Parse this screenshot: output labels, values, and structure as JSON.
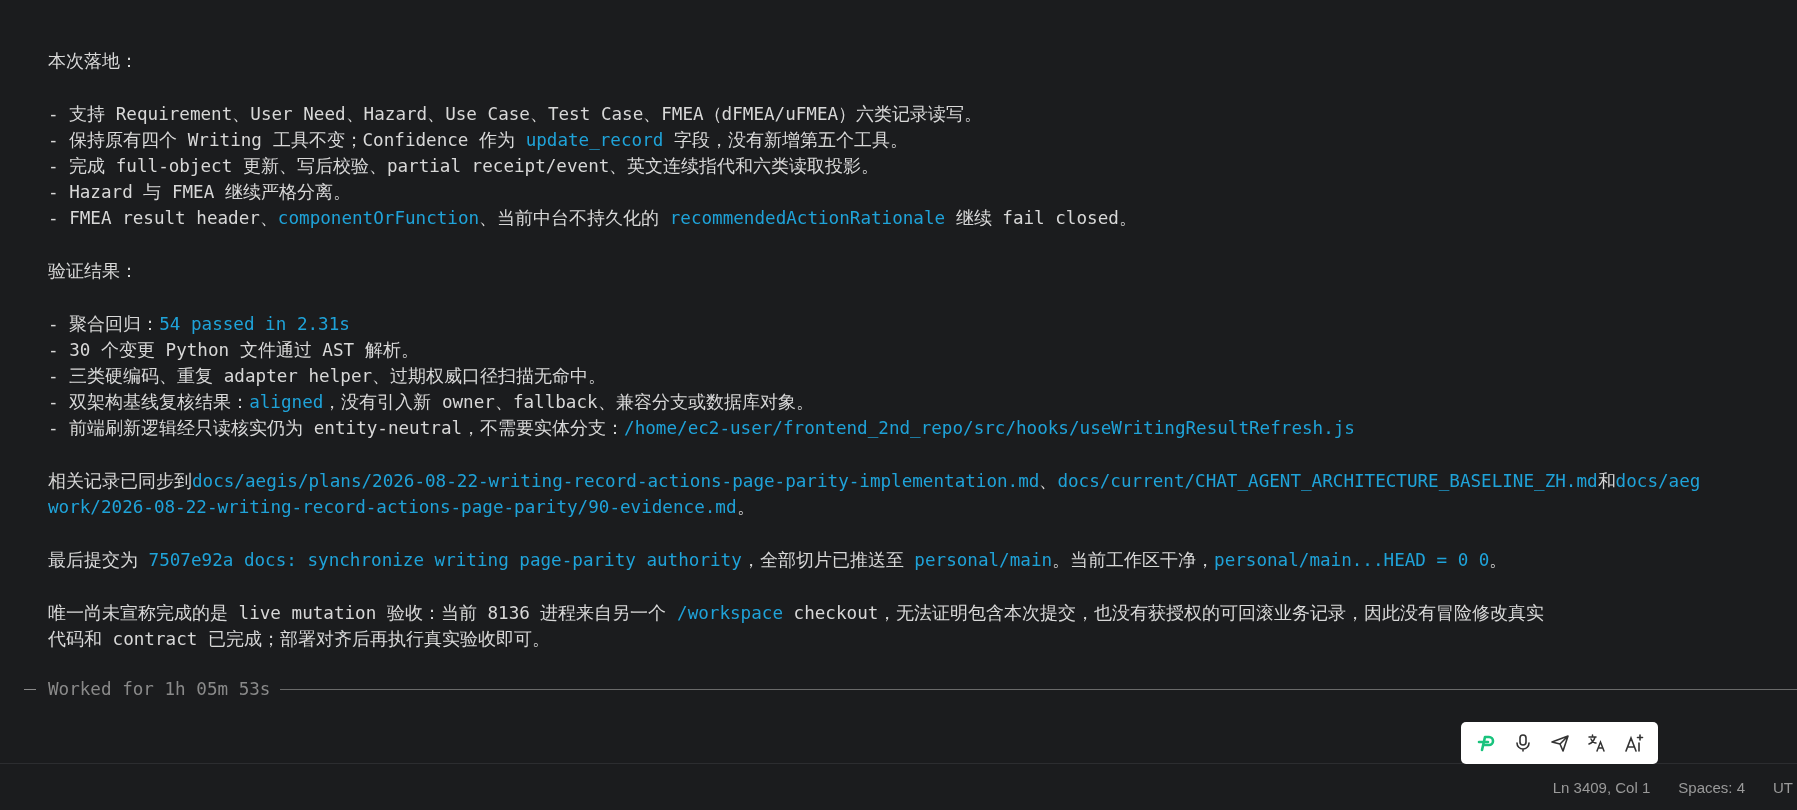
{
  "blocks": [
    {
      "lines": [
        [
          {
            "text": "本次落地：",
            "code": false
          }
        ]
      ]
    },
    {
      "lines": [
        [
          {
            "text": "- 支持 Requirement、User Need、Hazard、Use Case、Test Case、FMEA（dFMEA/uFMEA）六类记录读写。",
            "code": false
          }
        ],
        [
          {
            "text": "- 保持原有四个 Writing 工具不变；Confidence 作为 ",
            "code": false
          },
          {
            "text": "update_record",
            "code": true
          },
          {
            "text": " 字段，没有新增第五个工具。",
            "code": false
          }
        ],
        [
          {
            "text": "- 完成 full-object 更新、写后校验、partial receipt/event、英文连续指代和六类读取投影。",
            "code": false
          }
        ],
        [
          {
            "text": "- Hazard 与 FMEA 继续严格分离。",
            "code": false
          }
        ],
        [
          {
            "text": "- FMEA result header、",
            "code": false
          },
          {
            "text": "componentOrFunction",
            "code": true
          },
          {
            "text": "、当前中台不持久化的 ",
            "code": false
          },
          {
            "text": "recommendedActionRationale",
            "code": true
          },
          {
            "text": " 继续 fail closed。",
            "code": false
          }
        ]
      ]
    },
    {
      "lines": [
        [
          {
            "text": "验证结果：",
            "code": false
          }
        ]
      ]
    },
    {
      "lines": [
        [
          {
            "text": "- 聚合回归：",
            "code": false
          },
          {
            "text": "54 passed in 2.31s",
            "code": true
          }
        ],
        [
          {
            "text": "- 30 个变更 Python 文件通过 AST 解析。",
            "code": false
          }
        ],
        [
          {
            "text": "- 三类硬编码、重复 adapter helper、过期权威口径扫描无命中。",
            "code": false
          }
        ],
        [
          {
            "text": "- 双架构基线复核结果：",
            "code": false
          },
          {
            "text": "aligned",
            "code": true
          },
          {
            "text": "，没有引入新 owner、fallback、兼容分支或数据库对象。",
            "code": false
          }
        ],
        [
          {
            "text": "- 前端刷新逻辑经只读核实仍为 entity-neutral，不需要实体分支：",
            "code": false
          },
          {
            "text": "/home/ec2-user/frontend_2nd_repo/src/hooks/useWritingResultRefresh.js",
            "code": true
          }
        ]
      ]
    },
    {
      "lines": [
        [
          {
            "text": "相关记录已同步到",
            "code": false
          },
          {
            "text": "docs/aegis/plans/2026-08-22-writing-record-actions-page-parity-implementation.md",
            "code": true
          },
          {
            "text": "、",
            "code": false
          },
          {
            "text": "docs/current/CHAT_AGENT_ARCHITECTURE_BASELINE_ZH.md",
            "code": true
          },
          {
            "text": "和",
            "code": false
          },
          {
            "text": "docs/aeg",
            "code": true
          }
        ],
        [
          {
            "text": "work/2026-08-22-writing-record-actions-page-parity/90-evidence.md",
            "code": true
          },
          {
            "text": "。",
            "code": false
          }
        ]
      ]
    },
    {
      "lines": [
        [
          {
            "text": "最后提交为 ",
            "code": false
          },
          {
            "text": "7507e92a docs: synchronize writing page-parity authority",
            "code": true
          },
          {
            "text": "，全部切片已推送至 ",
            "code": false
          },
          {
            "text": "personal/main",
            "code": true
          },
          {
            "text": "。当前工作区干净，",
            "code": false
          },
          {
            "text": "personal/main...HEAD = 0 0",
            "code": true
          },
          {
            "text": "。",
            "code": false
          }
        ]
      ]
    },
    {
      "lines": [
        [
          {
            "text": "唯一尚未宣称完成的是 live mutation 验收：当前 8136 进程来自另一个 ",
            "code": false
          },
          {
            "text": "/workspace",
            "code": true
          },
          {
            "text": " checkout，无法证明包含本次提交，也没有获授权的可回滚业务记录，因此没有冒险修改真实",
            "code": false
          }
        ],
        [
          {
            "text": "代码和 contract 已完成；部署对齐后再执行真实验收即可。",
            "code": false
          }
        ]
      ]
    }
  ],
  "worked": "Worked for 1h 05m 53s",
  "status_bar": [
    "Ln 3409, Col 1",
    "Spaces: 4",
    "UT"
  ]
}
